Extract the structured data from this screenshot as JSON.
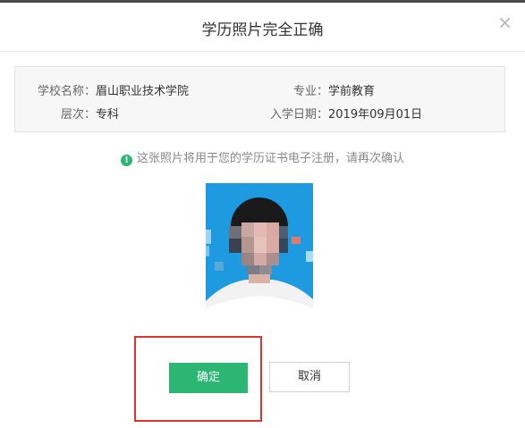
{
  "dialog": {
    "title": "学历照片完全正确",
    "close_glyph": "×"
  },
  "info": {
    "school_label": "学校名称：",
    "school_value": "眉山职业技术学院",
    "major_label": "专业：",
    "major_value": "学前教育",
    "level_label": "层次：",
    "level_value": "专科",
    "enroll_label": "入学日期：",
    "enroll_value": "2019年09月01日"
  },
  "notice": {
    "icon": "exclamation-circle-icon",
    "icon_glyph": "!",
    "text": "这张照片将用于您的学历证书电子注册，请再次确认"
  },
  "photo": {
    "background_color": "#1e9ae0"
  },
  "buttons": {
    "confirm_label": "确定",
    "cancel_label": "取消"
  },
  "colors": {
    "accent": "#2bb673",
    "highlight": "#e0322f"
  }
}
